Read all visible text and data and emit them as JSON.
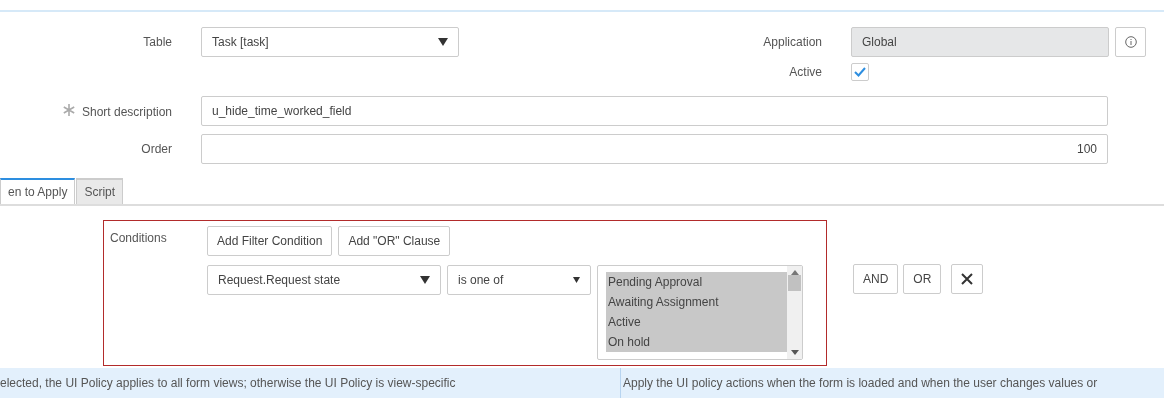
{
  "table_field": {
    "label": "Table",
    "value": "Task [task]"
  },
  "application_field": {
    "label": "Application",
    "value": "Global",
    "disabled": true
  },
  "active_field": {
    "label": "Active",
    "checked": true
  },
  "short_description": {
    "label": "Short description",
    "mandatory": true,
    "value": "u_hide_time_worked_field"
  },
  "order": {
    "label": "Order",
    "value": "100"
  },
  "tabs": [
    {
      "label": "en to Apply",
      "selected": true
    },
    {
      "label": "Script",
      "selected": false
    }
  ],
  "conditions": {
    "label": "Conditions",
    "buttons": [
      "Add Filter Condition",
      "Add \"OR\" Clause"
    ],
    "field": "Request.Request state",
    "operator": "is one of",
    "options": [
      {
        "label": "Pending Approval",
        "selected": true
      },
      {
        "label": "Awaiting Assignment",
        "selected": true
      },
      {
        "label": "Active",
        "selected": true
      },
      {
        "label": "On hold",
        "selected": true
      }
    ],
    "actions": [
      "AND",
      "OR"
    ]
  },
  "hints": [
    "elected, the UI Policy applies to all form views; otherwise the UI Policy is view-specific",
    "Apply the UI policy actions when the form is loaded and when the user changes values or"
  ]
}
